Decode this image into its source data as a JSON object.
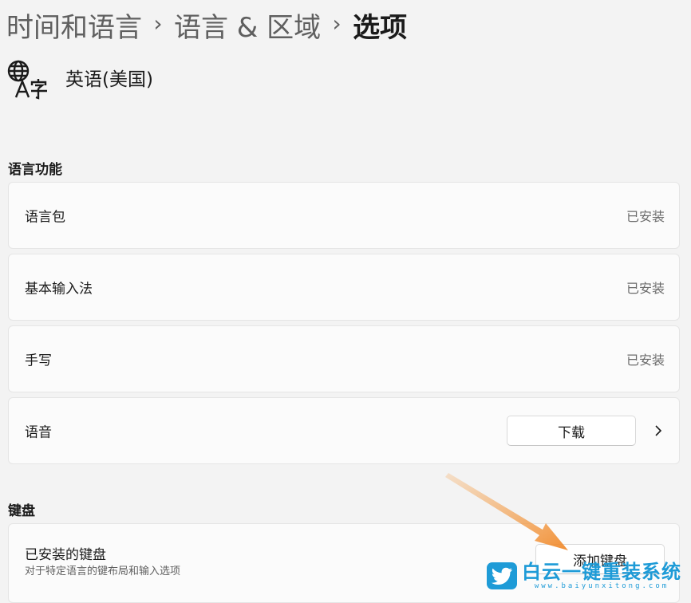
{
  "breadcrumb": {
    "items": [
      "时间和语言",
      "语言 & 区域",
      "选项"
    ],
    "separator": "›"
  },
  "language": {
    "name": "英语(美国)",
    "icon": "language-icon"
  },
  "sections": {
    "language_features": {
      "title": "语言功能",
      "rows": [
        {
          "label": "语言包",
          "status": "已安装"
        },
        {
          "label": "基本输入法",
          "status": "已安装"
        },
        {
          "label": "手写",
          "status": "已安装"
        },
        {
          "label": "语音",
          "button": "下载",
          "icon": "chevron-right-icon"
        }
      ]
    },
    "keyboard": {
      "title": "键盘",
      "installed": {
        "label": "已安装的键盘",
        "description": "对于特定语言的键布局和输入选项",
        "button": "添加键盘"
      }
    }
  },
  "watermark": {
    "title": "白云一键重装系统",
    "url": "www.baiyunxitong.com",
    "icon": "twitter-bird-icon"
  },
  "colors": {
    "background": "#f3f3f3",
    "card": "#fbfbfb",
    "annotation_arrow": "#f08a2c",
    "watermark": "#1e9bd7"
  }
}
